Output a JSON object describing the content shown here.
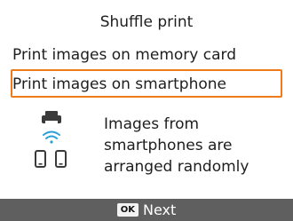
{
  "screen": {
    "title": "Shuffle print",
    "options": [
      {
        "label": "Print images on memory card",
        "selected": false
      },
      {
        "label": "Print images on smartphone",
        "selected": true
      }
    ],
    "description": {
      "lines": [
        "Images from",
        "smartphones are",
        "arranged randomly"
      ]
    },
    "icons": [
      "printer-icon",
      "wifi-icon",
      "smartphone-icon",
      "smartphone-icon"
    ],
    "footer": {
      "key_label": "OK",
      "action_label": "Next"
    },
    "colors": {
      "selection_border": "#ee7a1a",
      "wifi": "#2a9fd8",
      "footer_bg": "#5f5f5f"
    }
  }
}
